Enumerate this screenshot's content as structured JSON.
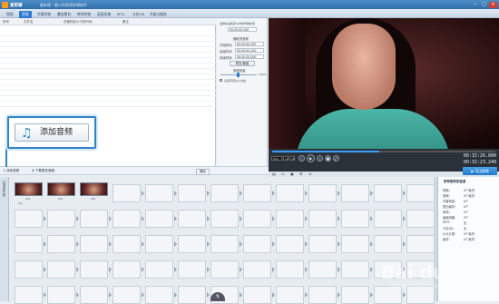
{
  "titlebar": {
    "app": "爱剪辑",
    "doc": "最新版 - 最火的视频剪辑软件",
    "min": "─",
    "max": "□",
    "close": "✕"
  },
  "tabs": [
    {
      "label": "视频"
    },
    {
      "label": "音频"
    },
    {
      "label": "字幕特效"
    },
    {
      "label": "叠加素材"
    },
    {
      "label": "转场特效"
    },
    {
      "label": "画面风格"
    },
    {
      "label": "MTV"
    },
    {
      "label": "卡拉OK"
    },
    {
      "label": "升级与服务"
    }
  ],
  "list_header": [
    "序号",
    "文件名",
    "在最终影片中的时间",
    "备注"
  ],
  "settings": {
    "title": "选择在最终影片中的开始时间",
    "time": "00:00:00.000",
    "section1": "截取的音频",
    "start_label": "开始时间",
    "start_val": "00:00:00.000",
    "end_label": "结束时间",
    "end_val": "00:00:00.000",
    "dur_label": "持续时间",
    "dur_val": "00:00:00.000",
    "preview_btn": "预览/截取",
    "section2": "音频音量",
    "vol_pct": "100%",
    "checkbox": "头尾声音淡入淡出",
    "confirm_btn": "确认修改"
  },
  "player": {
    "progress": 0.48,
    "time_current": "00:15:26.000",
    "time_total": "00:32:23.240",
    "mode_label": "ED4",
    "field2": "12",
    "field3": "2E"
  },
  "midtool": {
    "add_audio": "添加音频",
    "download": "下载更多音频",
    "delete": "删除"
  },
  "callout": {
    "text": "添加音频"
  },
  "export": {
    "label": "导出视频"
  },
  "storyboard": {
    "sidebar": "已添加片段",
    "thumbs": [
      "1/4",
      "2/4",
      "3/4"
    ],
    "extra": "1/1"
  },
  "info": {
    "title": "所有制作的信息",
    "rows": [
      {
        "k": "视频:",
        "v": "0个素材"
      },
      {
        "k": "音频:",
        "v": "0个素材"
      },
      {
        "k": "字幕特效:",
        "v": "0个"
      },
      {
        "k": "叠加素材:",
        "v": "0个"
      },
      {
        "k": "转场:",
        "v": "0个"
      },
      {
        "k": "画面风格:",
        "v": "0个"
      },
      {
        "k": "MTV:",
        "v": "无"
      },
      {
        "k": "卡拉OK:",
        "v": "无"
      },
      {
        "k": "片头片尾:",
        "v": "0个素材"
      },
      {
        "k": "素材:",
        "v": "0个素材"
      }
    ]
  },
  "watermark": {
    "big": "Bai du",
    "small": "jingyan.baidu.com"
  }
}
